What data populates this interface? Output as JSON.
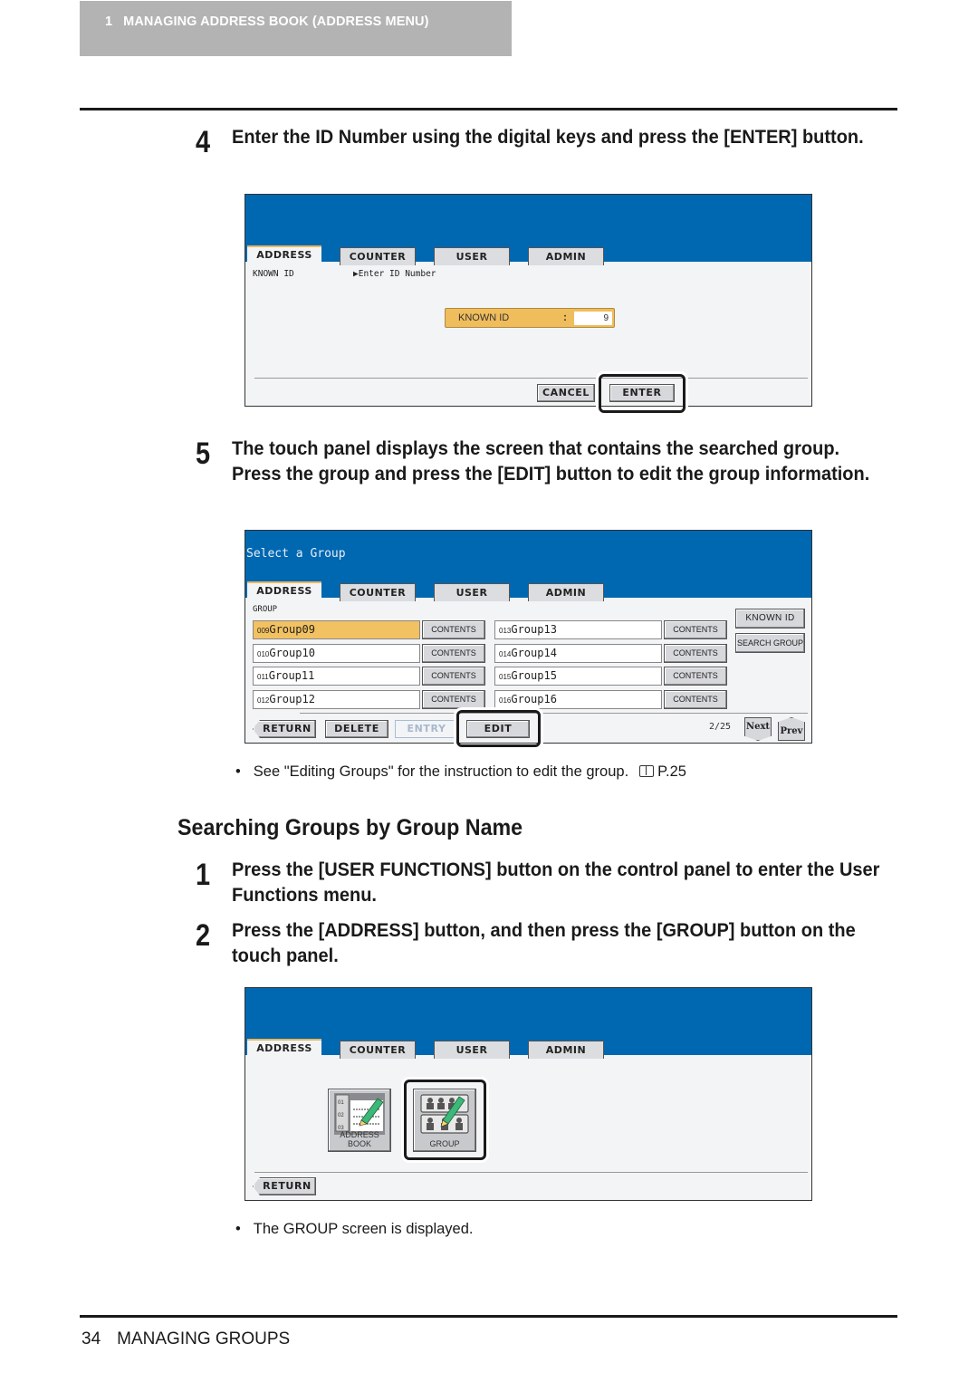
{
  "chapter_tab": {
    "number": "1",
    "title": "MANAGING ADDRESS BOOK (ADDRESS MENU)"
  },
  "steps_top": [
    {
      "number": "4",
      "text": "Enter the ID Number using the digital keys and press the [ENTER] button."
    },
    {
      "number": "5",
      "text": "The touch panel displays the screen that contains the searched group.  Press the group and press the [EDIT] button to edit the group information."
    }
  ],
  "tabs": [
    "ADDRESS",
    "COUNTER",
    "USER",
    "ADMIN"
  ],
  "screen_known_id": {
    "breadcrumb_left": "KNOWN ID",
    "breadcrumb_right": "▶Enter ID Number",
    "field_label": "KNOWN ID",
    "field_colon": ":",
    "field_value": "9",
    "cancel_label": "CANCEL",
    "enter_label": "ENTER"
  },
  "screen_select_group": {
    "title": "Select a Group",
    "section_label": "GROUP",
    "groups": [
      {
        "id": "009",
        "name": "Group09",
        "selected": true
      },
      {
        "id": "010",
        "name": "Group10",
        "selected": false
      },
      {
        "id": "011",
        "name": "Group11",
        "selected": false
      },
      {
        "id": "012",
        "name": "Group12",
        "selected": false
      },
      {
        "id": "013",
        "name": "Group13",
        "selected": false
      },
      {
        "id": "014",
        "name": "Group14",
        "selected": false
      },
      {
        "id": "015",
        "name": "Group15",
        "selected": false
      },
      {
        "id": "016",
        "name": "Group16",
        "selected": false
      }
    ],
    "contents_label": "CONTENTS",
    "known_id_label": "KNOWN ID",
    "search_group_label": "SEARCH GROUP",
    "return_label": "RETURN",
    "delete_label": "DELETE",
    "entry_label": "ENTRY",
    "edit_label": "EDIT",
    "page_indicator": "2/25",
    "next_label": "Next",
    "prev_label": "Prev"
  },
  "bullet_1": {
    "text": "See \"Editing Groups\" for the instruction to edit the group.",
    "ref": "P.25"
  },
  "section_heading": "Searching Groups by Group Name",
  "steps_bottom": [
    {
      "number": "1",
      "text": "Press the [USER FUNCTIONS] button on the control panel to enter the User Functions menu."
    },
    {
      "number": "2",
      "text": "Press the [ADDRESS] button, and then press the [GROUP] button on the touch panel."
    }
  ],
  "screen_address_menu": {
    "address_book_label": "ADDRESS BOOK",
    "group_label": "GROUP",
    "return_label": "RETURN"
  },
  "bullet_2": {
    "text": "The GROUP screen is displayed."
  },
  "footer": {
    "page_number": "34",
    "title": "MANAGING GROUPS"
  }
}
